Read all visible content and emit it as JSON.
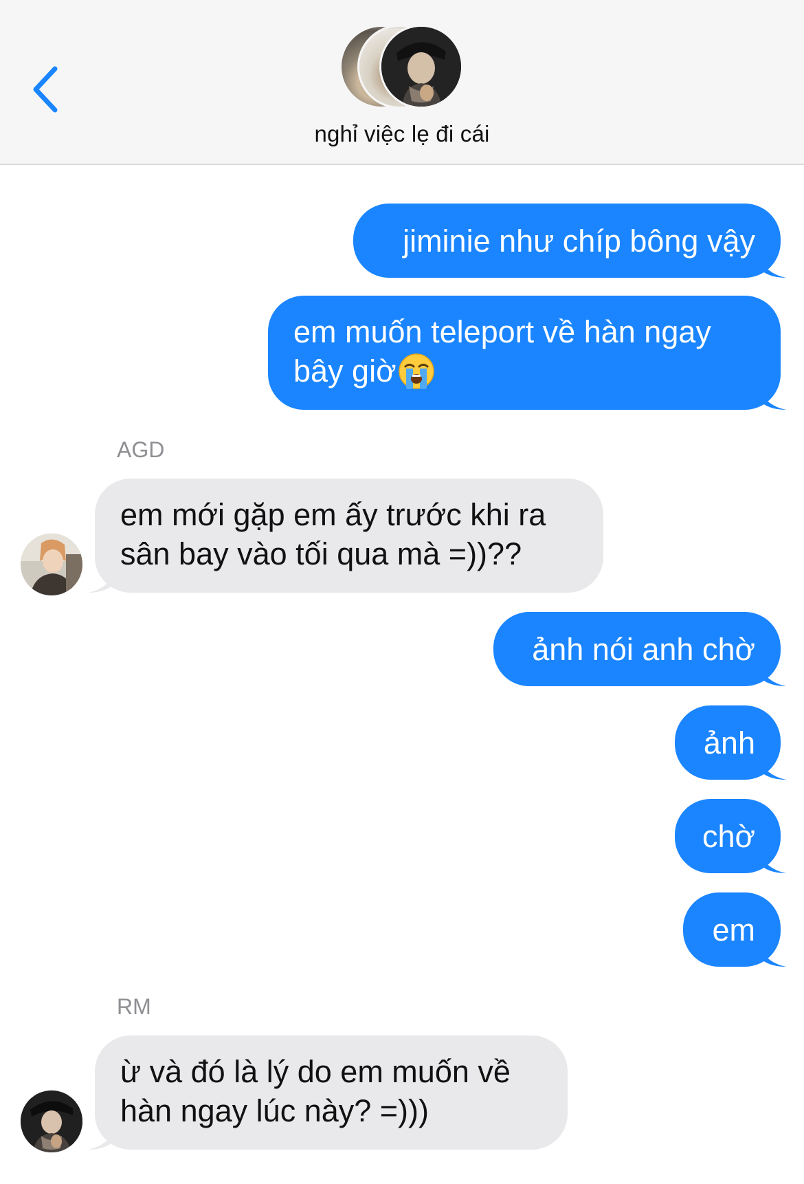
{
  "header": {
    "back_icon": "chevron-left-icon",
    "title": "nghỉ việc lẹ đi cái",
    "accent_color": "#1a85ff"
  },
  "messages": [
    {
      "direction": "outgoing",
      "text_lines": [
        "jiminie như chíp bông vậy"
      ]
    },
    {
      "direction": "outgoing",
      "text_lines": [
        "em muốn teleport về hàn ngay",
        "bây giờ"
      ],
      "emoji": "loudly-crying-face"
    },
    {
      "direction": "incoming",
      "sender": "AGD",
      "text_lines": [
        "em mới gặp em ấy trước khi ra",
        "sân bay vào tối qua mà =))??"
      ]
    },
    {
      "direction": "outgoing",
      "text_lines": [
        "ảnh nói anh chờ"
      ]
    },
    {
      "direction": "outgoing",
      "text_lines": [
        "ảnh"
      ]
    },
    {
      "direction": "outgoing",
      "text_lines": [
        "chờ"
      ]
    },
    {
      "direction": "outgoing",
      "text_lines": [
        "em"
      ]
    },
    {
      "direction": "incoming",
      "sender": "RM",
      "text_lines": [
        "ừ và đó là lý do em muốn về",
        "hàn ngay lúc này? =)))"
      ]
    }
  ],
  "colors": {
    "outgoing_bubble": "#1a85ff",
    "incoming_bubble": "#e9e9eb",
    "sender_label": "#8e8e93"
  }
}
